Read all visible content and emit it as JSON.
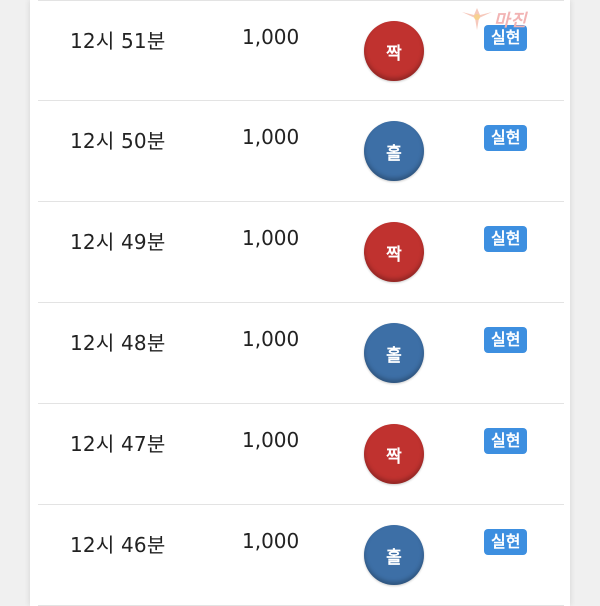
{
  "colors": {
    "even_ball": "#c0322f",
    "odd_ball": "#3d6fa6",
    "badge": "#3d8fe0"
  },
  "watermark": {
    "text": "마진",
    "icon": "wings-logo-icon"
  },
  "rows": [
    {
      "time": "12시 51분",
      "amount": "1,000",
      "result": "짝",
      "result_type": "even",
      "status": "실현"
    },
    {
      "time": "12시 50분",
      "amount": "1,000",
      "result": "홀",
      "result_type": "odd",
      "status": "실현"
    },
    {
      "time": "12시 49분",
      "amount": "1,000",
      "result": "짝",
      "result_type": "even",
      "status": "실현"
    },
    {
      "time": "12시 48분",
      "amount": "1,000",
      "result": "홀",
      "result_type": "odd",
      "status": "실현"
    },
    {
      "time": "12시 47분",
      "amount": "1,000",
      "result": "짝",
      "result_type": "even",
      "status": "실현"
    },
    {
      "time": "12시 46분",
      "amount": "1,000",
      "result": "홀",
      "result_type": "odd",
      "status": "실현"
    }
  ]
}
